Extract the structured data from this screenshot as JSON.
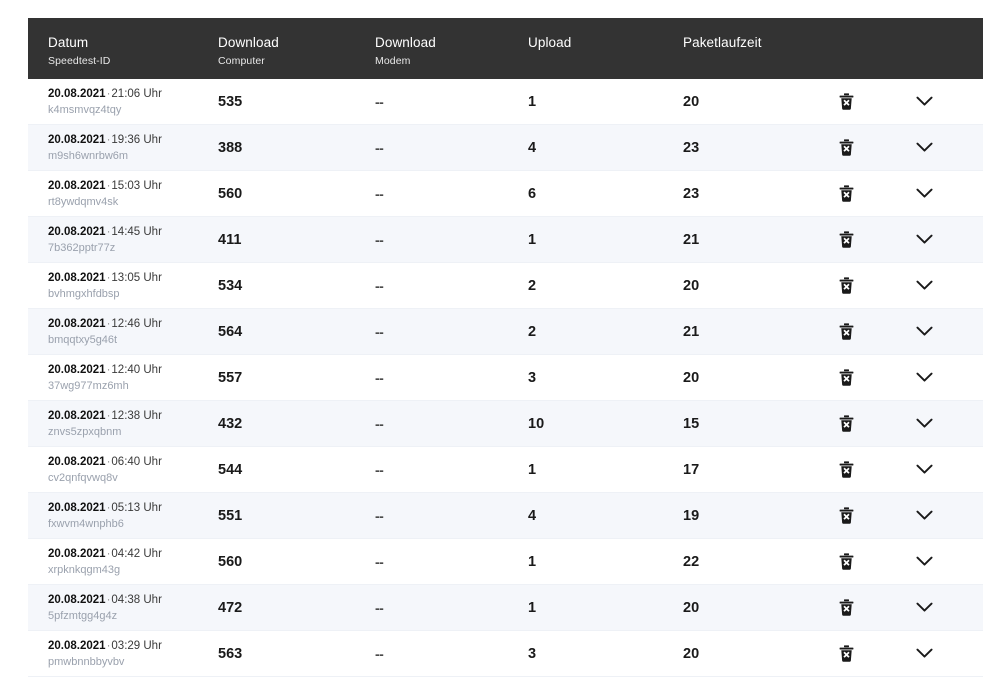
{
  "theme": {
    "header_bg": "#333333",
    "header_text": "#ffffff",
    "row_bg": "#ffffff",
    "row_alt_bg": "#f5f7fb",
    "row_border": "#eef1f6",
    "id_text": "#9aa1ad",
    "value_text": "#1a1a1a"
  },
  "table": {
    "columns": [
      {
        "key": "datum",
        "title": "Datum",
        "subtitle": "Speedtest-ID"
      },
      {
        "key": "download_pc",
        "title": "Download",
        "subtitle": "Computer"
      },
      {
        "key": "download_mod",
        "title": "Download",
        "subtitle": "Modem"
      },
      {
        "key": "upload",
        "title": "Upload",
        "subtitle": ""
      },
      {
        "key": "ping",
        "title": "Paketlaufzeit",
        "subtitle": ""
      },
      {
        "key": "delete",
        "title": "",
        "subtitle": ""
      },
      {
        "key": "expand",
        "title": "",
        "subtitle": ""
      }
    ],
    "icons": {
      "delete": "trash-delete-icon",
      "expand": "chevron-down-icon"
    },
    "rows": [
      {
        "date": "20.08.2021",
        "sep": "·",
        "time": "21:06 Uhr",
        "id": "k4msmvqz4tqy",
        "download_computer": "535",
        "download_modem": "--",
        "upload": "1",
        "ping": "20"
      },
      {
        "date": "20.08.2021",
        "sep": "·",
        "time": "19:36 Uhr",
        "id": "m9sh6wnrbw6m",
        "download_computer": "388",
        "download_modem": "--",
        "upload": "4",
        "ping": "23"
      },
      {
        "date": "20.08.2021",
        "sep": "·",
        "time": "15:03 Uhr",
        "id": "rt8ywdqmv4sk",
        "download_computer": "560",
        "download_modem": "--",
        "upload": "6",
        "ping": "23"
      },
      {
        "date": "20.08.2021",
        "sep": "·",
        "time": "14:45 Uhr",
        "id": "7b362pptr77z",
        "download_computer": "411",
        "download_modem": "--",
        "upload": "1",
        "ping": "21"
      },
      {
        "date": "20.08.2021",
        "sep": "·",
        "time": "13:05 Uhr",
        "id": "bvhmgxhfdbsp",
        "download_computer": "534",
        "download_modem": "--",
        "upload": "2",
        "ping": "20"
      },
      {
        "date": "20.08.2021",
        "sep": "·",
        "time": "12:46 Uhr",
        "id": "bmqqtxy5g46t",
        "download_computer": "564",
        "download_modem": "--",
        "upload": "2",
        "ping": "21"
      },
      {
        "date": "20.08.2021",
        "sep": "·",
        "time": "12:40 Uhr",
        "id": "37wg977mz6mh",
        "download_computer": "557",
        "download_modem": "--",
        "upload": "3",
        "ping": "20"
      },
      {
        "date": "20.08.2021",
        "sep": "·",
        "time": "12:38 Uhr",
        "id": "znvs5zpxqbnm",
        "download_computer": "432",
        "download_modem": "--",
        "upload": "10",
        "ping": "15"
      },
      {
        "date": "20.08.2021",
        "sep": "·",
        "time": "06:40 Uhr",
        "id": "cv2qnfqvwq8v",
        "download_computer": "544",
        "download_modem": "--",
        "upload": "1",
        "ping": "17"
      },
      {
        "date": "20.08.2021",
        "sep": "·",
        "time": "05:13 Uhr",
        "id": "fxwvm4wnphb6",
        "download_computer": "551",
        "download_modem": "--",
        "upload": "4",
        "ping": "19"
      },
      {
        "date": "20.08.2021",
        "sep": "·",
        "time": "04:42 Uhr",
        "id": "xrpknkqgm43g",
        "download_computer": "560",
        "download_modem": "--",
        "upload": "1",
        "ping": "22"
      },
      {
        "date": "20.08.2021",
        "sep": "·",
        "time": "04:38 Uhr",
        "id": "5pfzmtgg4g4z",
        "download_computer": "472",
        "download_modem": "--",
        "upload": "1",
        "ping": "20"
      },
      {
        "date": "20.08.2021",
        "sep": "·",
        "time": "03:29 Uhr",
        "id": "pmwbnnbbyvbv",
        "download_computer": "563",
        "download_modem": "--",
        "upload": "3",
        "ping": "20"
      }
    ]
  }
}
